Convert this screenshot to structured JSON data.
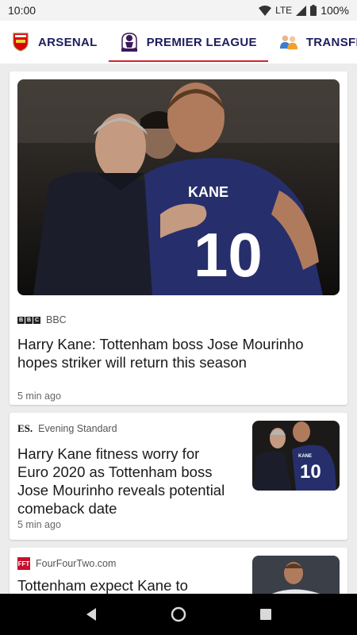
{
  "status": {
    "time": "10:00",
    "network": "LTE",
    "battery": "100%"
  },
  "tabs": [
    {
      "label": "ARSENAL",
      "icon": "arsenal-crest-icon",
      "active": false
    },
    {
      "label": "PREMIER LEAGUE",
      "icon": "premier-league-lion-icon",
      "active": true
    },
    {
      "label": "TRANSFER",
      "icon": "transfer-people-icon",
      "active": false
    }
  ],
  "colors": {
    "accent": "#d5232f",
    "tab_text": "#1d1d5e",
    "background": "#ececec"
  },
  "articles": [
    {
      "source": "BBC",
      "headline": "Harry Kane: Tottenham boss Jose Mourinho hopes striker will return this season",
      "time": "5 min ago",
      "image": {
        "shirt_name": "KANE",
        "shirt_number": "10"
      }
    },
    {
      "source_logo": "ES.",
      "source": "Evening Standard",
      "headline": "Harry Kane fitness worry for Euro 2020 as Tottenham boss Jose Mourinho reveals potential comeback date",
      "time": "5 min ago",
      "image": {
        "shirt_name": "KANE",
        "shirt_number": "10"
      }
    },
    {
      "source_logo": "FFT",
      "source": "FourFourTwo.com",
      "headline": "Tottenham expect Kane to"
    }
  ]
}
